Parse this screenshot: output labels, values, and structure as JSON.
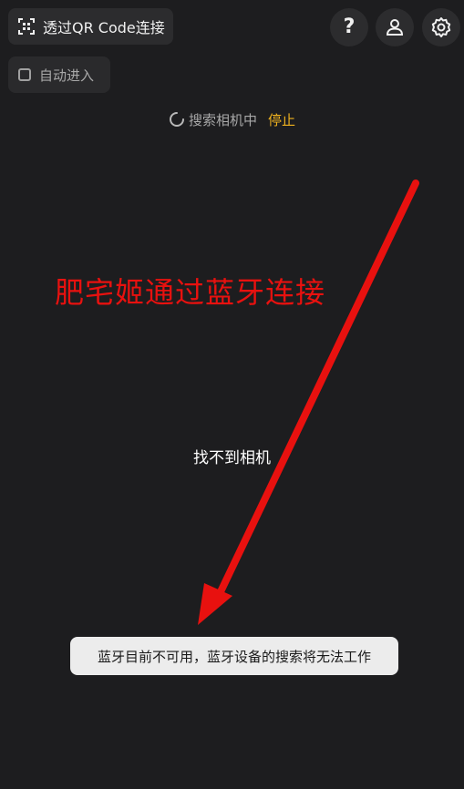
{
  "header": {
    "qr_connect_label": "透过QR Code连接",
    "qr_icon": "qr-scan-icon",
    "help_icon": "question-icon",
    "help_glyph": "?",
    "account_icon": "person-icon",
    "settings_icon": "gear-icon"
  },
  "auto_enter": {
    "label": "自动进入",
    "checked": false
  },
  "search": {
    "status_text": "搜索相机中",
    "stop_label": "停止",
    "spinner_icon": "loading-spinner-icon"
  },
  "overlay": {
    "annotation_text": "肥宅姬通过蓝牙连接",
    "arrow_icon": "red-arrow"
  },
  "main": {
    "empty_state": "找不到相机"
  },
  "toast": {
    "message": "蓝牙目前不可用，蓝牙设备的搜索将无法工作"
  },
  "colors": {
    "background": "#1d1d1f",
    "button_bg": "#2c2c2e",
    "accent": "#f0b21f",
    "annotation_red": "#e8110f",
    "toast_bg": "#ececec"
  }
}
